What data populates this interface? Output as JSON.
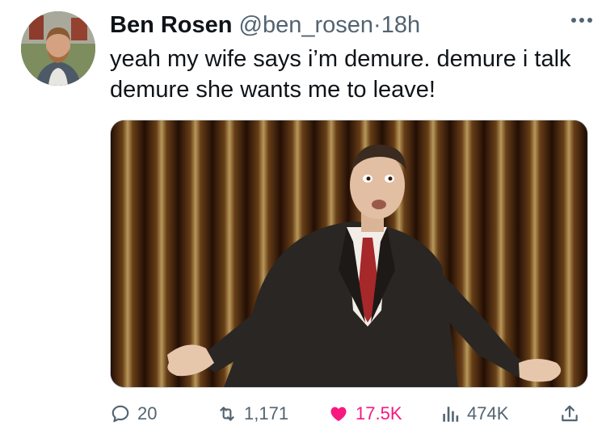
{
  "tweet": {
    "author_name": "Ben Rosen",
    "handle": "@ben_rosen",
    "separator": "·",
    "time": "18h",
    "text": "yeah my wife says i’m demure. demure i talk demure she wants me to leave!"
  },
  "actions": {
    "replies": "20",
    "reposts": "1,171",
    "likes": "17.5K",
    "views": "474K"
  },
  "colors": {
    "like_active": "#f91880",
    "secondary_text": "#536471",
    "primary_text": "#0f1419"
  },
  "icons": [
    "more-icon",
    "reply-icon",
    "repost-icon",
    "like-icon",
    "views-icon",
    "share-icon"
  ]
}
